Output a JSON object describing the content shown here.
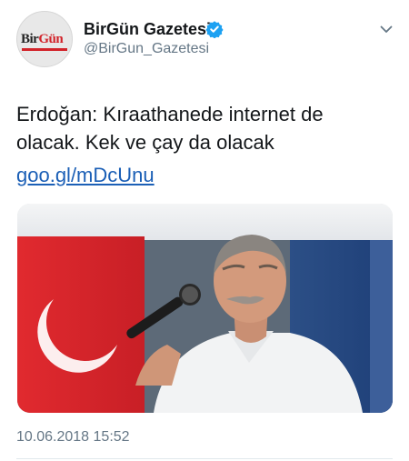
{
  "account": {
    "name": "BirGün Gazetesi",
    "handle": "@BirGun_Gazetesi",
    "verified": true,
    "avatar_logo": "BirGün"
  },
  "tweet": {
    "text_lines": [
      "Erdoğan: Kıraathanede internet de",
      "olacak. Kek ve çay da olacak"
    ],
    "link": "goo.gl/mDcUnu",
    "timestamp": "10.06.2018 15:52"
  },
  "icons": {
    "verified": "verified-badge-icon",
    "menu": "chevron-down-icon"
  },
  "colors": {
    "text": "#14171a",
    "secondary": "#657786",
    "link": "#1b5fb6",
    "verified": "#1da1f2",
    "brand_red": "#d2232a"
  }
}
